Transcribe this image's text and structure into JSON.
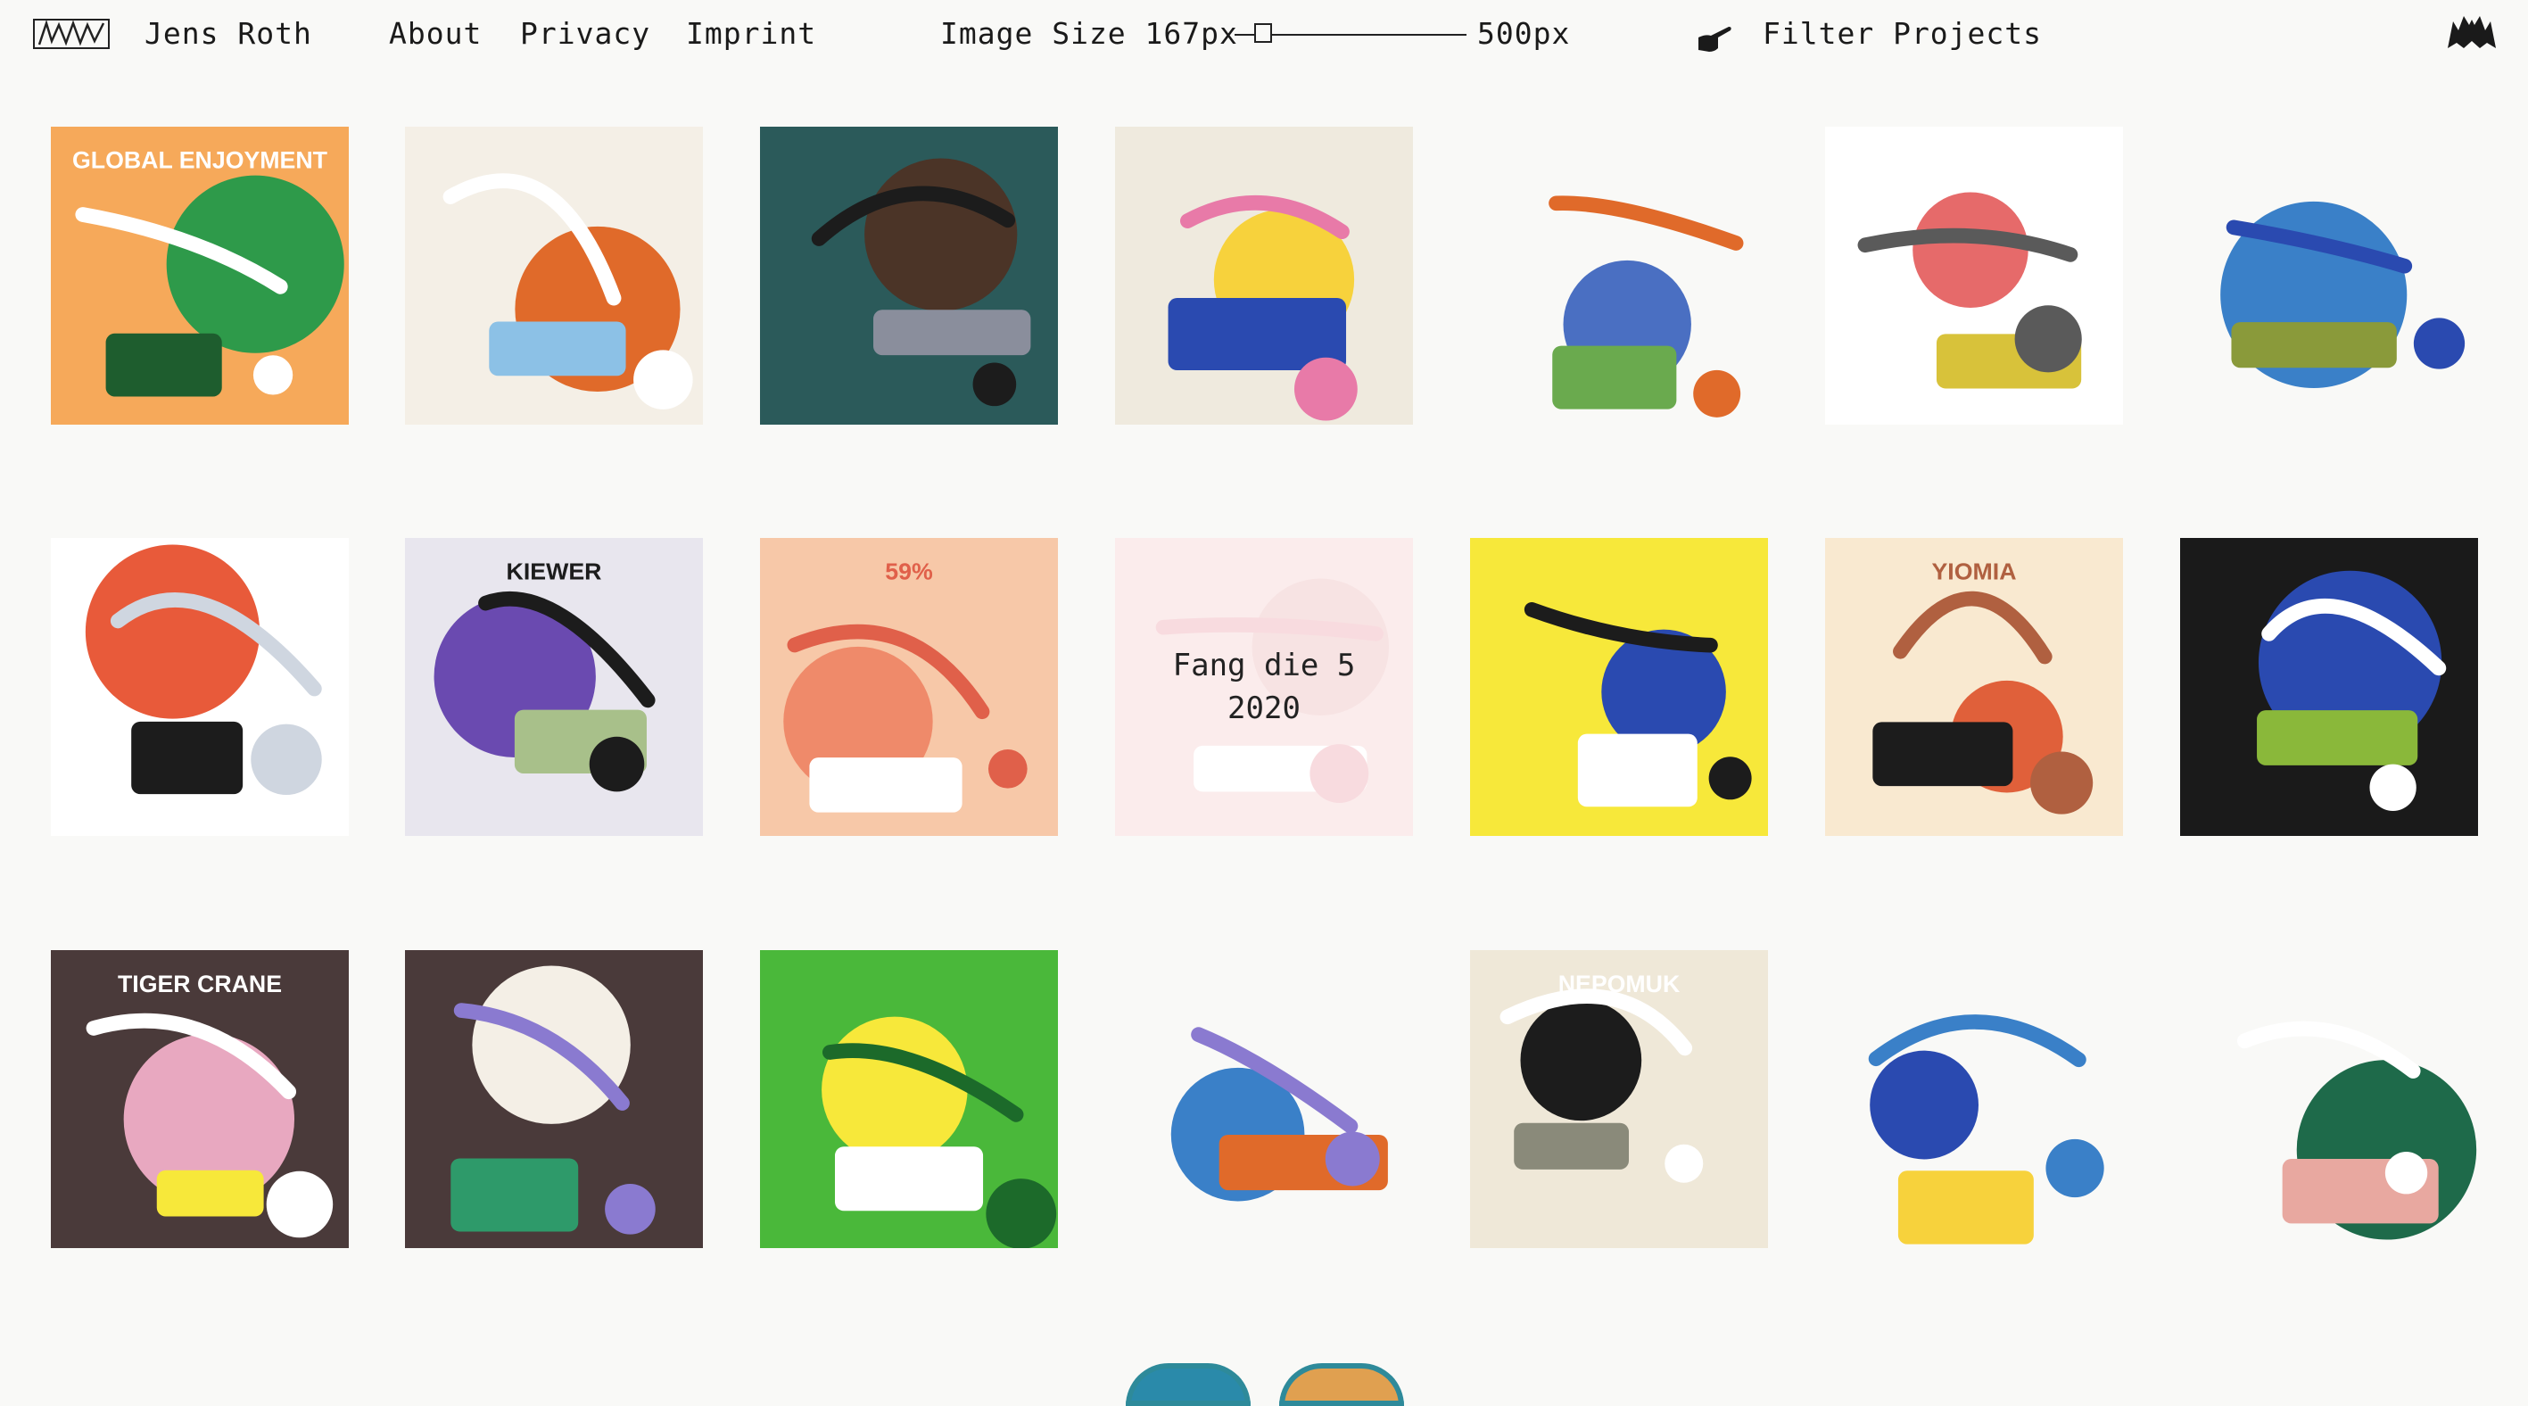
{
  "nav": {
    "name": "Jens Roth",
    "links": [
      "About",
      "Privacy",
      "Imprint"
    ],
    "image_size_label": "Image Size 167px",
    "image_size_max": "500px",
    "slider_value": 0.09,
    "filter_label": "Filter Projects"
  },
  "rows": [
    [
      {
        "id": "global-enjoyment",
        "text": "GLOBAL ENJOYMENT",
        "pal": [
          "#f6a95a",
          "#2e9a4a",
          "#1e5d2e",
          "#ffffff"
        ]
      },
      {
        "id": "chef-selfie",
        "pal": [
          "#f4efe6",
          "#e06a2a",
          "#8cc1e6",
          "#ffffff"
        ]
      },
      {
        "id": "bed-beater",
        "pal": [
          "#2b5a5a",
          "#4b3427",
          "#8a8e9c",
          "#1c1c1c"
        ]
      },
      {
        "id": "music-band",
        "pal": [
          "#efeade",
          "#f7d23c",
          "#2a4ab0",
          "#e87aa8"
        ]
      },
      {
        "id": "earth-soup",
        "pal": [
          "#f9f9f7",
          "#4a6fc2",
          "#6aaa4e",
          "#e06a2a"
        ]
      },
      {
        "id": "fridge",
        "pal": [
          "#ffffff",
          "#e66a6a",
          "#d8c23a",
          "#5a5a5a"
        ]
      },
      {
        "id": "man-vacuum",
        "pal": [
          "#f9f9f7",
          "#3a80c8",
          "#8a9a3a",
          "#2a4ab0"
        ]
      }
    ],
    [
      {
        "id": "ladder-planet",
        "pal": [
          "#ffffff",
          "#e85a3a",
          "#1c1c1c",
          "#cfd6e0"
        ]
      },
      {
        "id": "kiewer-hunde",
        "text": "KIEWER",
        "pal": [
          "#e8e6ee",
          "#6a4ab0",
          "#a8c08a",
          "#1c1c1c"
        ]
      },
      {
        "id": "methan-cow",
        "text": "59%",
        "pal": [
          "#f7c8a8",
          "#ef8a6a",
          "#ffffff",
          "#e0604a"
        ]
      },
      {
        "id": "fang-die-5",
        "caption": [
          "Fang die 5",
          "2020"
        ],
        "pal": [
          "#f6d6d6",
          "#eec0c0",
          "#ffffff",
          "#f0b0b8"
        ]
      },
      {
        "id": "picnic-blanket",
        "pal": [
          "#f7e83a",
          "#2a4ab0",
          "#ffffff",
          "#1c1c1c"
        ]
      },
      {
        "id": "hands-poster",
        "text": "YIOMIA",
        "pal": [
          "#f9e9d0",
          "#e0603a",
          "#1c1c1c",
          "#b06040"
        ]
      },
      {
        "id": "kettles-triptych",
        "pal": [
          "#1a1a1a",
          "#2a4ab0",
          "#8ab83a",
          "#ffffff"
        ]
      }
    ],
    [
      {
        "id": "tiger-crane",
        "text": "TIGER CRANE",
        "pal": [
          "#4a3a3a",
          "#e8a8c0",
          "#f7e83a",
          "#ffffff"
        ]
      },
      {
        "id": "birds-circle",
        "pal": [
          "#4a3a3a",
          "#f4efe6",
          "#2e9a6a",
          "#8a7ad0"
        ]
      },
      {
        "id": "stopwatch-cycling",
        "pal": [
          "#4ab83a",
          "#f7e83a",
          "#ffffff",
          "#1c6a2a"
        ]
      },
      {
        "id": "dancers",
        "pal": [
          "#f9f9f7",
          "#3a80c8",
          "#e06a2a",
          "#8a7ad0"
        ]
      },
      {
        "id": "rettungsring",
        "text": "NEPOMUK",
        "pal": [
          "#efe8d8",
          "#1c1c1c",
          "#8a8a7a",
          "#ffffff"
        ]
      },
      {
        "id": "phone-figure",
        "pal": [
          "#f9f9f7",
          "#2a4ab0",
          "#f7d23c",
          "#3a80c8"
        ]
      },
      {
        "id": "woman-food-hat",
        "pal": [
          "#f9f9f7",
          "#1e6a4a",
          "#e8a8a0",
          "#ffffff"
        ]
      }
    ]
  ],
  "partial": [
    "#2a8aaa",
    "#e0a050"
  ]
}
